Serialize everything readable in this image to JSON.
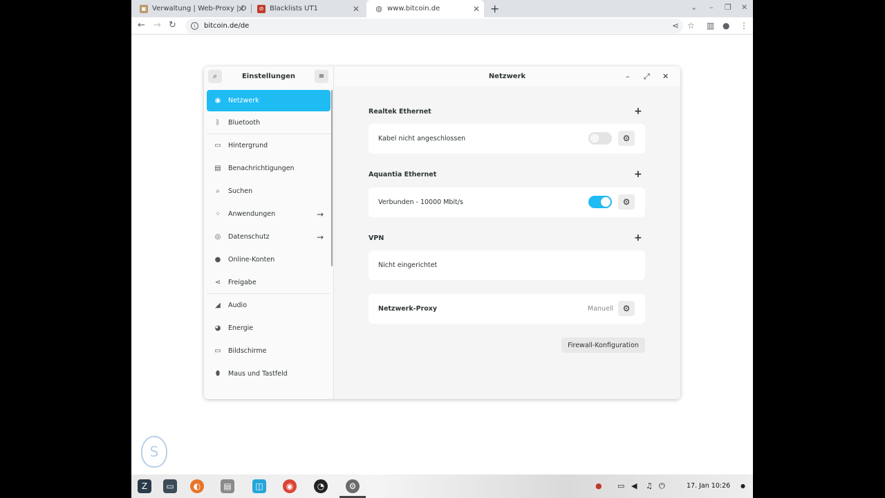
{
  "browser": {
    "tabs": [
      {
        "title": "Verwaltung | Web-Proxy | D",
        "favicon": "proxy-favicon"
      },
      {
        "title": "Blacklists UT1",
        "favicon": "blacklist-favicon"
      },
      {
        "title": "www.bitcoin.de",
        "favicon": "globe-favicon"
      }
    ],
    "url": "bitcoin.de/de"
  },
  "settings": {
    "sidebar_title": "Einstellungen",
    "main_title": "Netzwerk",
    "sidebar_items": [
      {
        "label": "Netzwerk",
        "icon": "network-icon",
        "active": true
      },
      {
        "label": "Bluetooth",
        "icon": "bluetooth-icon"
      },
      {
        "label": "Hintergrund",
        "icon": "background-icon"
      },
      {
        "label": "Benachrichtigungen",
        "icon": "notifications-icon"
      },
      {
        "label": "Suchen",
        "icon": "search-icon"
      },
      {
        "label": "Anwendungen",
        "icon": "apps-icon",
        "arrow": true
      },
      {
        "label": "Datenschutz",
        "icon": "privacy-icon",
        "arrow": true
      },
      {
        "label": "Online-Konten",
        "icon": "online-accounts-icon"
      },
      {
        "label": "Freigabe",
        "icon": "share-icon"
      },
      {
        "label": "Audio",
        "icon": "audio-icon"
      },
      {
        "label": "Energie",
        "icon": "power-icon"
      },
      {
        "label": "Bildschirme",
        "icon": "display-icon"
      },
      {
        "label": "Maus und Tastfeld",
        "icon": "mouse-icon"
      }
    ],
    "sections": {
      "realtek": {
        "title": "Realtek Ethernet",
        "status": "Kabel nicht angeschlossen",
        "enabled": false
      },
      "aquantia": {
        "title": "Aquantia Ethernet",
        "status": "Verbunden - 10000 Mbit/s",
        "enabled": true
      },
      "vpn": {
        "title": "VPN",
        "status": "Nicht eingerichtet"
      },
      "proxy": {
        "label": "Netzwerk-Proxy",
        "value": "Manuell"
      }
    },
    "firewall_button": "Firewall-Konfiguration"
  },
  "taskbar": {
    "clock": "17. Jan  10:26"
  },
  "colors": {
    "accent": "#1fbcf3"
  }
}
